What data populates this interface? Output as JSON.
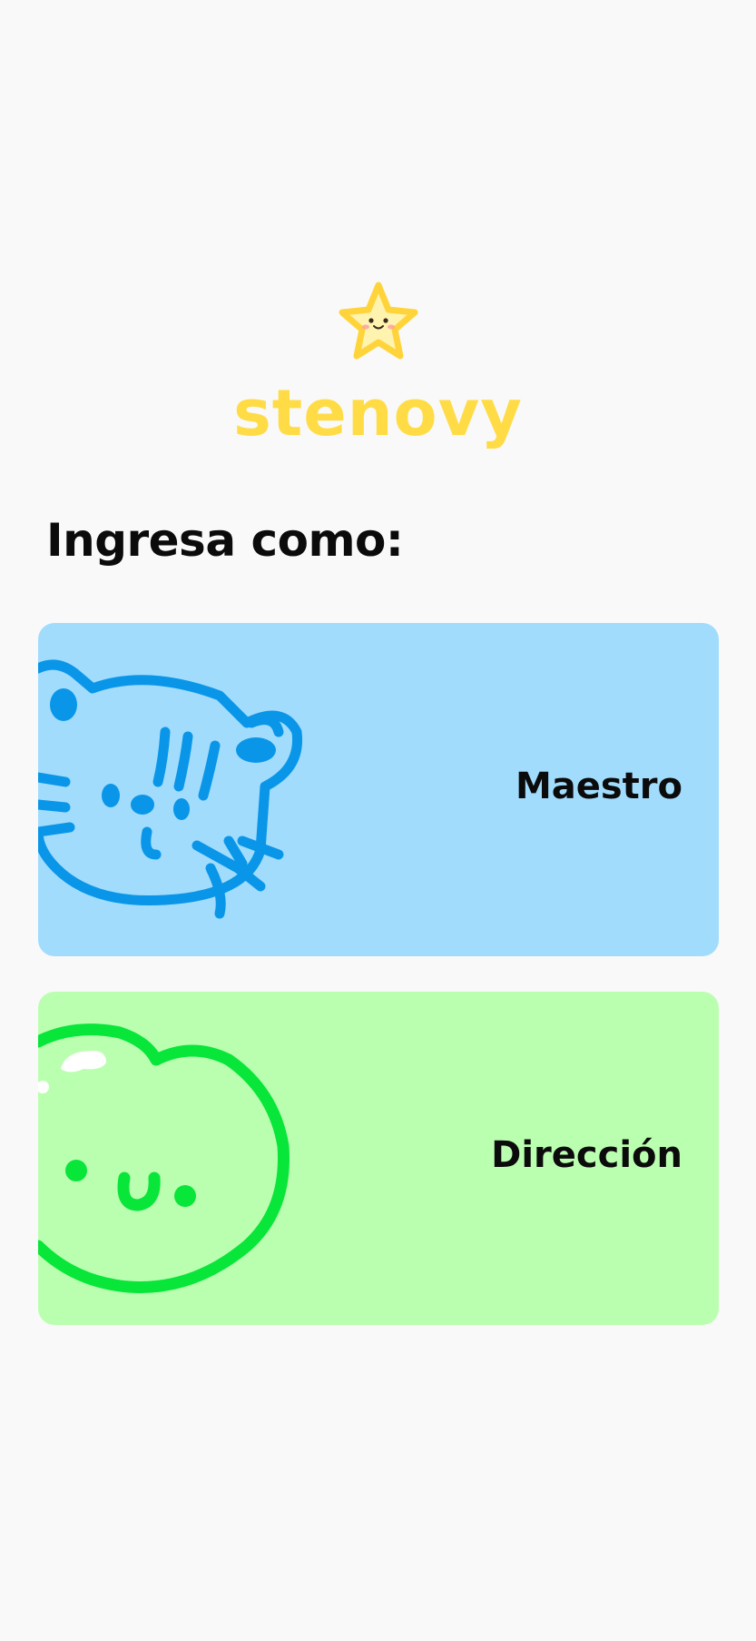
{
  "app": {
    "brand_name": "stenovy",
    "logo_icon": "star-face-icon"
  },
  "login": {
    "heading": "Ingresa como:"
  },
  "roles": [
    {
      "label": "Maestro",
      "illustration": "cat-face-icon",
      "background": "#a1dcfd",
      "accent": "#0a96e8"
    },
    {
      "label": "Dirección",
      "illustration": "apple-face-icon",
      "background": "#baffaf",
      "accent": "#08e63a"
    }
  ],
  "colors": {
    "background": "#f9f9f9",
    "brand": "#ffdc45",
    "text": "#0b0b0b"
  }
}
